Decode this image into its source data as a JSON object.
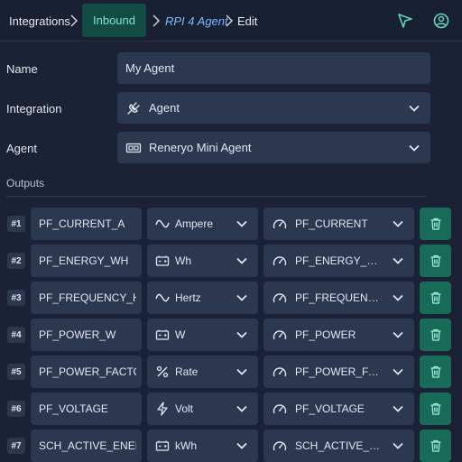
{
  "breadcrumb": {
    "integrations": "Integrations",
    "inbound": "Inbound",
    "agent": "RPI 4 Agent",
    "edit": "Edit"
  },
  "header_icons": [
    "send-icon",
    "user-circle-icon"
  ],
  "form": {
    "name_label": "Name",
    "name_value": "My Agent",
    "integration_label": "Integration",
    "integration_value": "Agent",
    "integration_icon": "plug-icon",
    "agent_label": "Agent",
    "agent_value": "Reneryo Mini Agent",
    "agent_icon": "device-icon"
  },
  "outputs": {
    "title": "Outputs",
    "rows": [
      {
        "num": "#1",
        "name": "PF_CURRENT_A",
        "unit": "Ampere",
        "unit_icon": "wave-icon",
        "metric": "PF_CURRENT"
      },
      {
        "num": "#2",
        "name": "PF_ENERGY_WH",
        "unit": "Wh",
        "unit_icon": "battery-icon",
        "metric": "PF_ENERGY_DELTA"
      },
      {
        "num": "#3",
        "name": "PF_FREQUENCY_HZ",
        "unit": "Hertz",
        "unit_icon": "wave-icon",
        "metric": "PF_FREQUENCY"
      },
      {
        "num": "#4",
        "name": "PF_POWER_W",
        "unit": "W",
        "unit_icon": "battery-icon",
        "metric": "PF_POWER"
      },
      {
        "num": "#5",
        "name": "PF_POWER_FACTOR",
        "unit": "Rate",
        "unit_icon": "percent-icon",
        "metric": "PF_POWER_FACTOR"
      },
      {
        "num": "#6",
        "name": "PF_VOLTAGE",
        "unit": "Volt",
        "unit_icon": "bolt-icon",
        "metric": "PF_VOLTAGE"
      },
      {
        "num": "#7",
        "name": "SCH_ACTIVE_ENERGY",
        "unit": "kWh",
        "unit_icon": "battery-icon",
        "metric": "SCH_ACTIVE_ENERGY"
      }
    ]
  },
  "colors": {
    "background": "#1b2236",
    "field": "#2c3750",
    "accent_green": "#176b57",
    "accent_blue": "#7ab8ff",
    "inbound_bg": "#134b45",
    "inbound_text": "#7ee6c6"
  }
}
